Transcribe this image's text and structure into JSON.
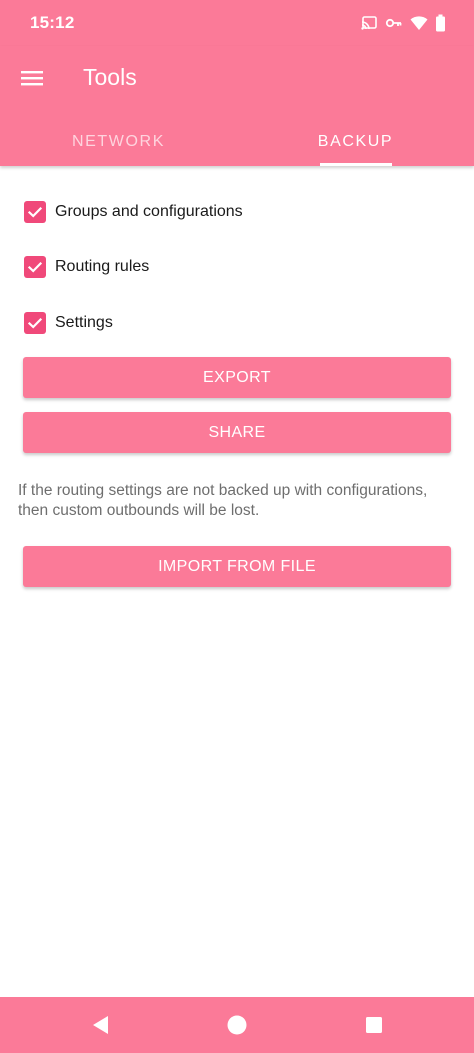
{
  "status_bar": {
    "time": "15:12",
    "icons": [
      "cast-icon",
      "vpn-key-icon",
      "wifi-icon",
      "battery-icon"
    ]
  },
  "app_bar": {
    "title": "Tools",
    "menu_icon": "hamburger-menu-icon",
    "tabs": [
      {
        "label": "NETWORK",
        "selected": false
      },
      {
        "label": "BACKUP",
        "selected": true
      }
    ]
  },
  "backup": {
    "options": [
      {
        "label": "Groups and configurations",
        "checked": true
      },
      {
        "label": "Routing rules",
        "checked": true
      },
      {
        "label": "Settings",
        "checked": true
      }
    ],
    "export_label": "EXPORT",
    "share_label": "SHARE",
    "info_text": "If the routing settings are not backed up with configurations, then custom outbounds will be lost.",
    "import_label": "IMPORT FROM FILE"
  },
  "nav_bar": {
    "buttons": [
      "back-icon",
      "home-icon",
      "recents-icon"
    ]
  },
  "colors": {
    "accent": "#fb7a98",
    "checkbox": "#f0497a",
    "text": "#1a1a1a",
    "secondary_text": "#6e6e6e"
  }
}
